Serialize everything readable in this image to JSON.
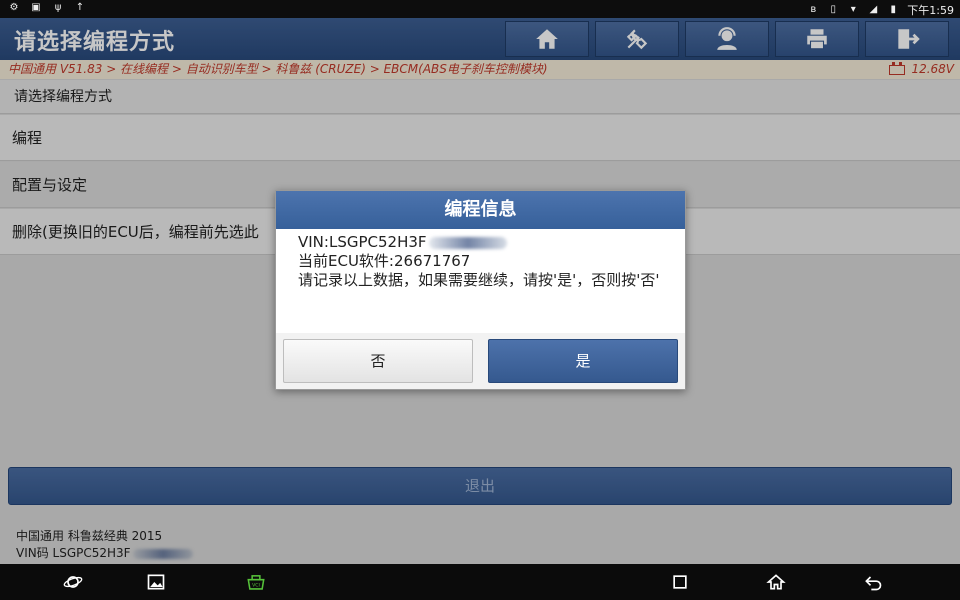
{
  "status_bar": {
    "time": "下午1:59",
    "left_icons": [
      "settings-icon",
      "image-icon",
      "usb-icon",
      "upload-icon"
    ],
    "right_icons": [
      "bluetooth-icon",
      "vibrate-icon",
      "wifi-icon",
      "signal-icon",
      "battery-icon"
    ]
  },
  "header": {
    "title": "请选择编程方式",
    "buttons": [
      "home-icon",
      "diagnostic-icon",
      "support-icon",
      "print-icon",
      "exit-icon"
    ]
  },
  "breadcrumb": {
    "text": "中国通用 V51.83 > 在线编程 > 自动识别车型 > 科鲁兹 (CRUZE) > EBCM(ABS电子刹车控制模块)",
    "voltage": "12.68V"
  },
  "list": {
    "section_label": "请选择编程方式",
    "items": [
      {
        "label": "编程"
      },
      {
        "label": "配置与设定"
      },
      {
        "label": "删除(更换旧的ECU后，编程前先选此"
      }
    ]
  },
  "exit_label": "退出",
  "footer": {
    "line1": "中国通用 科鲁兹经典 2015",
    "line2": "VIN码 LSGPC52H3F"
  },
  "dialog": {
    "title": "编程信息",
    "vin_line": "VIN:LSGPC52H3F",
    "ecu_line": "当前ECU软件:26671767",
    "message": "请记录以上数据，如果需要继续，请按'是'，否则按'否'",
    "no_label": "否",
    "yes_label": "是"
  },
  "navbar": {
    "icons": [
      "browser-icon",
      "gallery-icon",
      "vci-icon",
      "recent-apps-icon",
      "home-icon",
      "back-icon"
    ]
  },
  "colors": {
    "header": "#2f5185",
    "breadcrumb_text": "#c0392b",
    "dialog_title": "#416aa4"
  }
}
